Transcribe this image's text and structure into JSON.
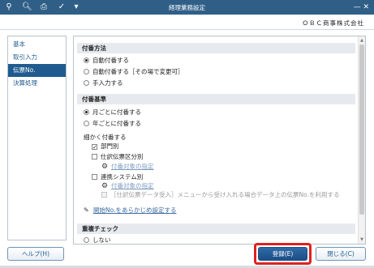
{
  "window": {
    "title": "経理業務設定",
    "company": "ＯＢＣ商事株式会社"
  },
  "toolbar": {
    "icons": [
      "add-person-icon",
      "search-icon",
      "print-icon",
      "check-mark-icon",
      "dropdown-icon"
    ],
    "window_controls": "— ✕"
  },
  "sidebar": {
    "items": [
      {
        "label": "基本",
        "active": false
      },
      {
        "label": "取引入力",
        "active": false
      },
      {
        "label": "伝票No.",
        "active": true
      },
      {
        "label": "決算処理",
        "active": false
      }
    ]
  },
  "content": {
    "sec1": {
      "title": "付番方法",
      "options": [
        {
          "label": "自動付番する",
          "selected": true
        },
        {
          "label": "自動付番する［その場で変更可］",
          "selected": false
        },
        {
          "label": "手入力する",
          "selected": false
        }
      ]
    },
    "sec2": {
      "title": "付番基準",
      "options": [
        {
          "label": "月ごとに付番する",
          "selected": true
        },
        {
          "label": "年ごとに付番する",
          "selected": false
        }
      ],
      "fine_label": "細かく付番する",
      "dept": {
        "label": "部門別",
        "checked": true
      },
      "journal": {
        "label": "仕訳伝票区分別",
        "checked": false,
        "link": "付番対象の指定"
      },
      "linked": {
        "label": "連携システム別",
        "checked": false,
        "link": "付番対象の指定"
      },
      "import_note": "［仕訳伝票データ受入］メニューから受け入れる場合データ上の伝票No.を利用する",
      "preset_link": "開始No.をあらかじめ設定する"
    },
    "sec3": {
      "title": "重複チェック",
      "options": [
        {
          "label": "しない",
          "selected": false
        }
      ]
    }
  },
  "buttons": {
    "help": "ヘルプ(H)",
    "register": "登録(E)",
    "close": "閉じる(C)"
  },
  "colors": {
    "titlebar": "#2f5f87",
    "accent": "#1f5b8f",
    "highlight": "#e02020"
  }
}
